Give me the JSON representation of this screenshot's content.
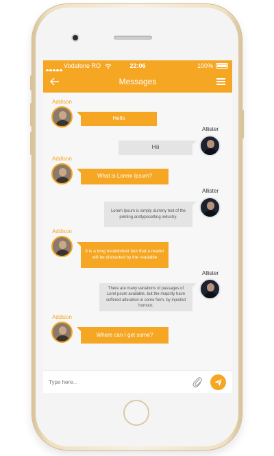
{
  "status_bar": {
    "carrier": "Vodafone RO",
    "time": "22:06",
    "battery": "100%"
  },
  "header": {
    "title": "Messages",
    "back_icon": "arrow-left-icon",
    "menu_icon": "hamburger-menu-icon"
  },
  "messages": [
    {
      "sender": "Addison",
      "text": "Hello"
    },
    {
      "sender": "Allister",
      "text": "Hiii"
    },
    {
      "sender": "Addison",
      "text": "What is Lorem Ipsum?"
    },
    {
      "sender": "Allister",
      "text": "Lorem Ipsum is simply dummy text of the printing andtypesetting industry."
    },
    {
      "sender": "Addison",
      "text": "It is a long established fact that a reader will be distracted by the readable"
    },
    {
      "sender": "Allister",
      "text": "There are many variations of passages of Lorel psum available, but the majority have suffered alteration in some form, by injected humour,"
    },
    {
      "sender": "Addison",
      "text": "Where can I get some?"
    }
  ],
  "composer": {
    "placeholder": "Type here...",
    "attach_icon": "paperclip-icon",
    "send_icon": "send-icon"
  },
  "colors": {
    "accent": "#f5a623",
    "incoming_bubble": "#e4e4e4",
    "background": "#f7f7f7"
  }
}
